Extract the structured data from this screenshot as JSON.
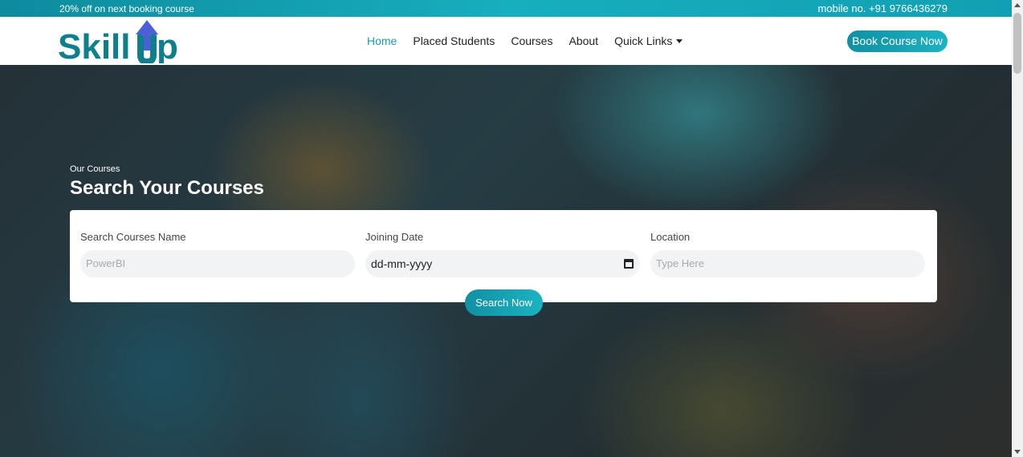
{
  "topbar": {
    "promo": "20% off on next booking course",
    "phone": "mobile no. +91 9766436279"
  },
  "navbar": {
    "logo_text_left": "Skill",
    "logo_text_right": "p",
    "links": [
      "Home",
      "Placed Students",
      "Courses",
      "About",
      "Quick Links"
    ],
    "active": "Home",
    "cta": "Book Course Now"
  },
  "hero": {
    "subtitle": "Our Courses",
    "title": "Search Your Courses"
  },
  "search": {
    "fields": [
      {
        "label": "Search Courses Name",
        "placeholder": "PowerBI"
      },
      {
        "label": "Joining Date",
        "value": "dd-mm-yyyy"
      },
      {
        "label": "Location",
        "placeholder": "Type Here"
      }
    ],
    "button": "Search Now"
  },
  "colors": {
    "accent": "#1a9cb0",
    "logo_teal": "#0f7f8c",
    "logo_arrow": "#4b5fd6"
  },
  "icons": [
    "calendar-icon",
    "caret-down-icon"
  ]
}
